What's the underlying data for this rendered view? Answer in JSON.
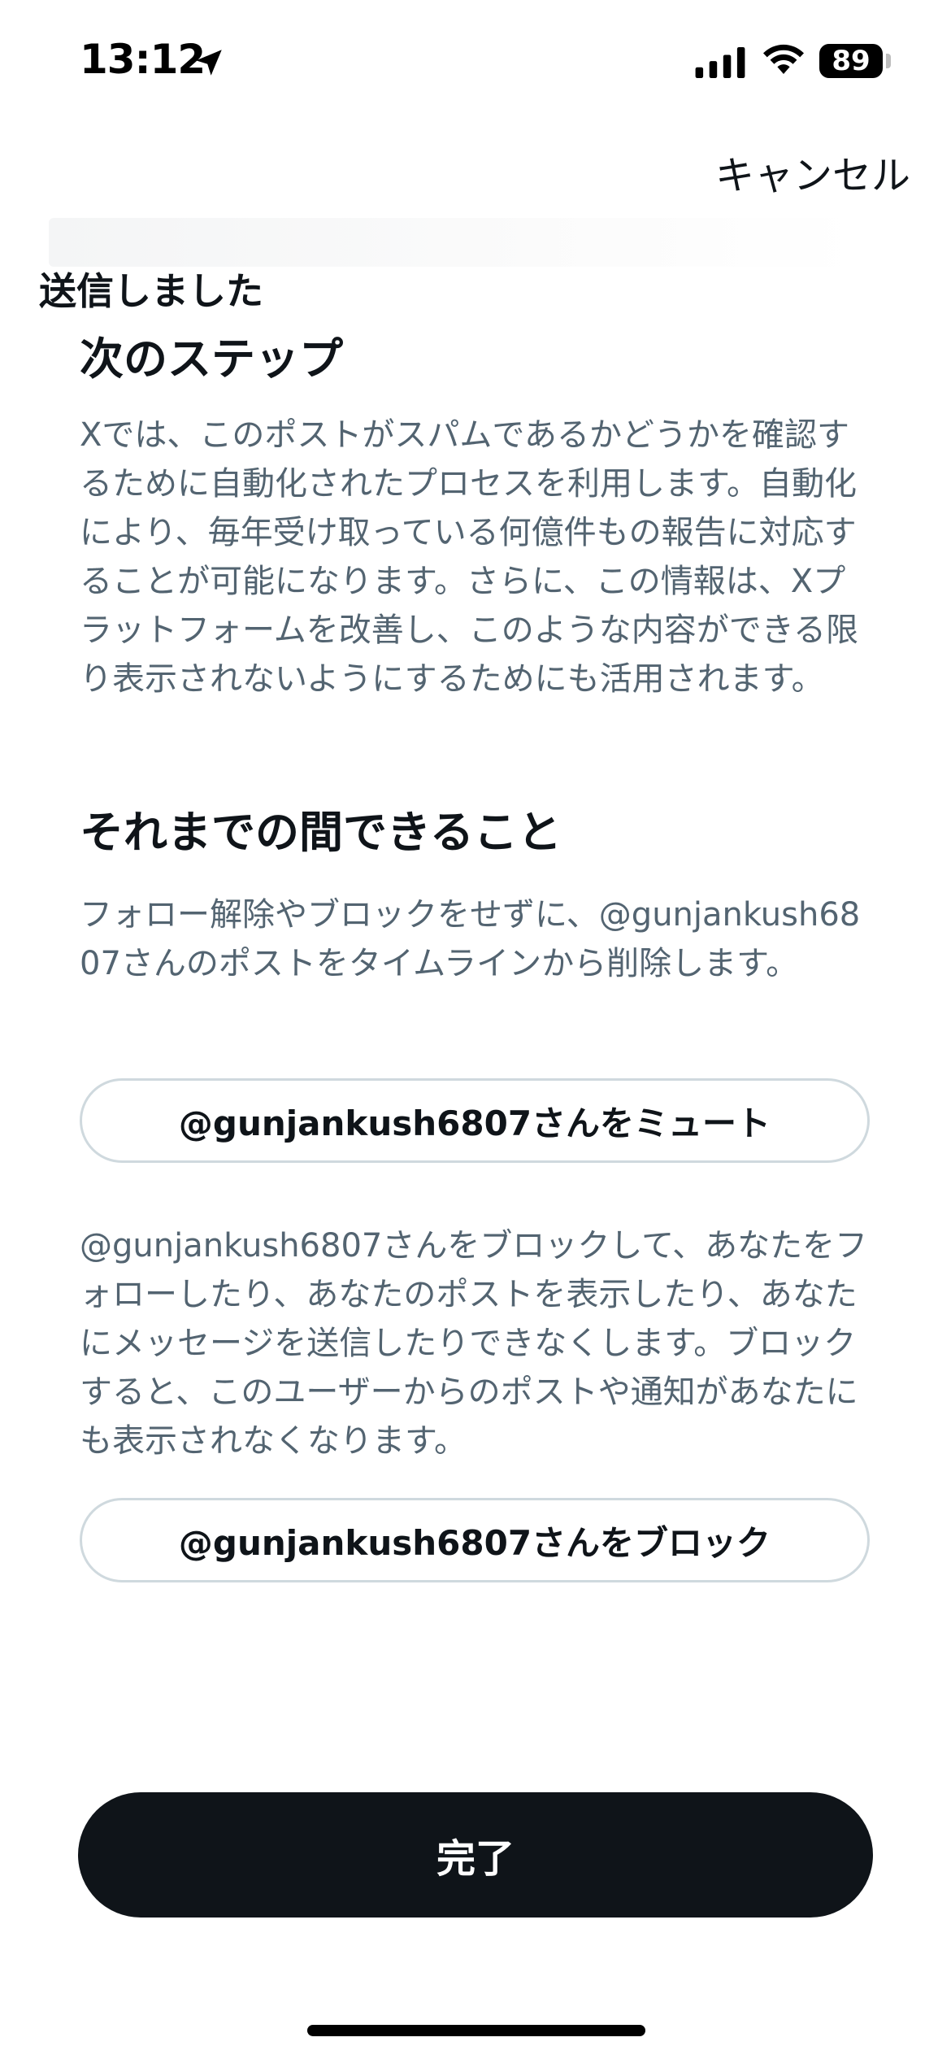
{
  "status_bar": {
    "time": "13:12",
    "battery": "89",
    "icons": [
      "location-arrow-icon",
      "cellular-signal-icon",
      "wifi-icon",
      "battery-icon"
    ]
  },
  "header": {
    "cancel_label": "キャンセル"
  },
  "sent_label": "送信しました",
  "next_steps": {
    "heading": "次のステップ",
    "body": "Xでは、このポストがスパムであるかどうかを確認するために自動化されたプロセスを利用します。自動化により、毎年受け取っている何億件もの報告に対応することが可能になります。さらに、この情報は、Xプラットフォームを改善し、このような内容ができる限り表示されないようにするためにも活用されます。"
  },
  "meanwhile": {
    "heading": "それまでの間できること",
    "mute_description": "フォロー解除やブロックをせずに、@gunjankush6807さんのポストをタイムラインから削除します。",
    "mute_button": "@gunjankush6807さんをミュート",
    "block_description": "@gunjankush6807さんをブロックして、あなたをフォローしたり、あなたのポストを表示したり、あなたにメッセージを送信したりできなくします。ブロックすると、このユーザーからのポストや通知があなたにも表示されなくなります。",
    "block_button": "@gunjankush6807さんをブロック"
  },
  "footer": {
    "done_label": "完了"
  },
  "colors": {
    "text_primary": "#0f1419",
    "text_secondary": "#536471",
    "border": "#cfd9de",
    "button_dark": "#0f1419"
  }
}
